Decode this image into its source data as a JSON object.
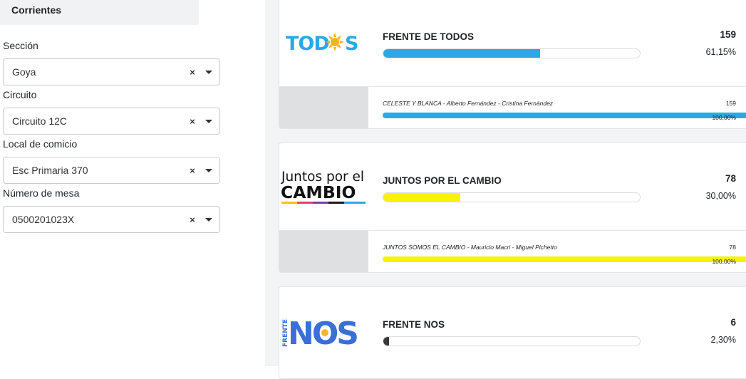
{
  "sidebar": {
    "province": "Corrientes",
    "fields": [
      {
        "label": "Sección",
        "value": "Goya"
      },
      {
        "label": "Circuito",
        "value": "Circuito 12C"
      },
      {
        "label": "Local de comicio",
        "value": "Esc Primaria 370"
      },
      {
        "label": "Número de mesa",
        "value": "0500201023X"
      }
    ],
    "clear_icon": "×"
  },
  "results": [
    {
      "party": "FRENTE DE TODOS",
      "logo_text": "TODOS",
      "votes": "159",
      "percent": "61,15%",
      "share": 0.6115,
      "color": "#29a9e6",
      "candidate": {
        "list": "CELESTE Y BLANCA - Alberto Fernández - Cristina Fernández",
        "votes": "159",
        "percent": "100,00%",
        "share": 1.0
      }
    },
    {
      "party": "JUNTOS POR EL CAMBIO",
      "logo_text_1": "Juntos por el",
      "logo_text_2": "CAMBIO",
      "votes": "78",
      "percent": "30,00%",
      "share": 0.3,
      "color": "#f8f400",
      "candidate": {
        "list": "JUNTOS SOMOS EL CAMBIO - Mauricio Macri - Miguel Pichetto",
        "votes": "78",
        "percent": "100,00%",
        "share": 1.0
      }
    },
    {
      "party": "FRENTE NOS",
      "logo_text_1": "FRENTE",
      "logo_text_2": "NOS",
      "votes": "6",
      "percent": "2,30%",
      "share": 0.023,
      "color": "#3a3a3a"
    }
  ]
}
